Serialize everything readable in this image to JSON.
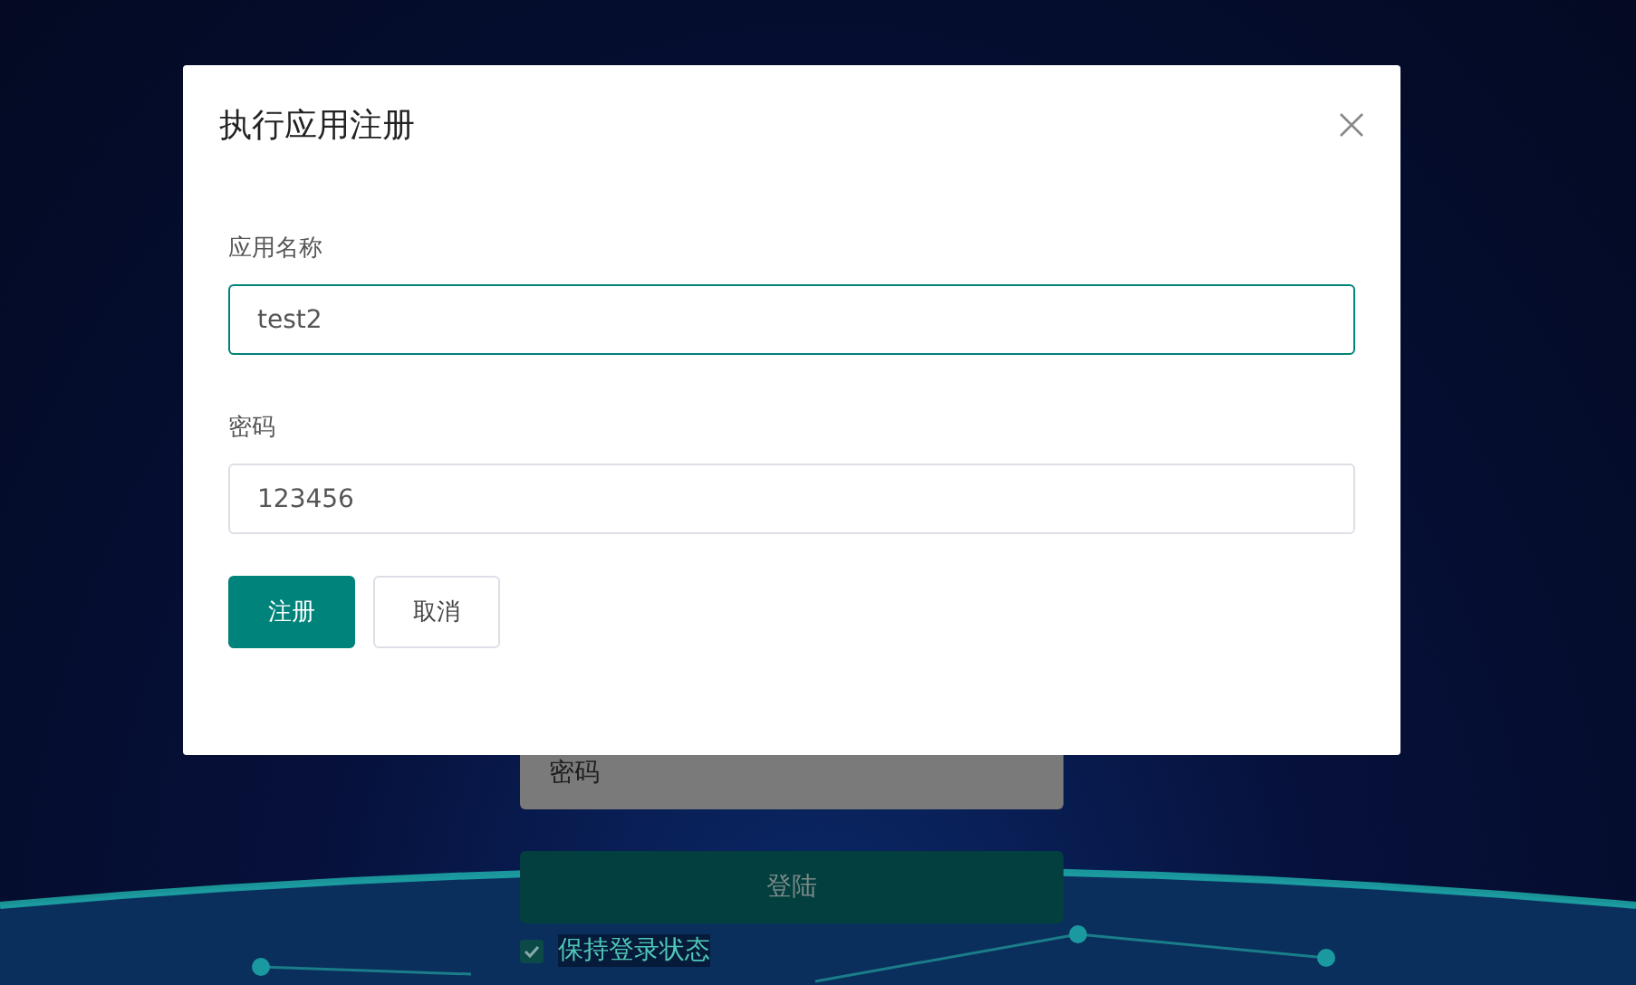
{
  "login_form": {
    "password_placeholder": "密码",
    "login_button": "登陆",
    "remember": {
      "label": "保持登录状态",
      "checked": true
    }
  },
  "dialog": {
    "title": "执行应用注册",
    "fields": [
      {
        "label": "应用名称",
        "value": "test2",
        "focused": true
      },
      {
        "label": "密码",
        "value": "123456",
        "focused": false
      }
    ],
    "buttons": [
      {
        "label": "注册",
        "kind": "primary"
      },
      {
        "label": "取消",
        "kind": "default"
      }
    ]
  }
}
